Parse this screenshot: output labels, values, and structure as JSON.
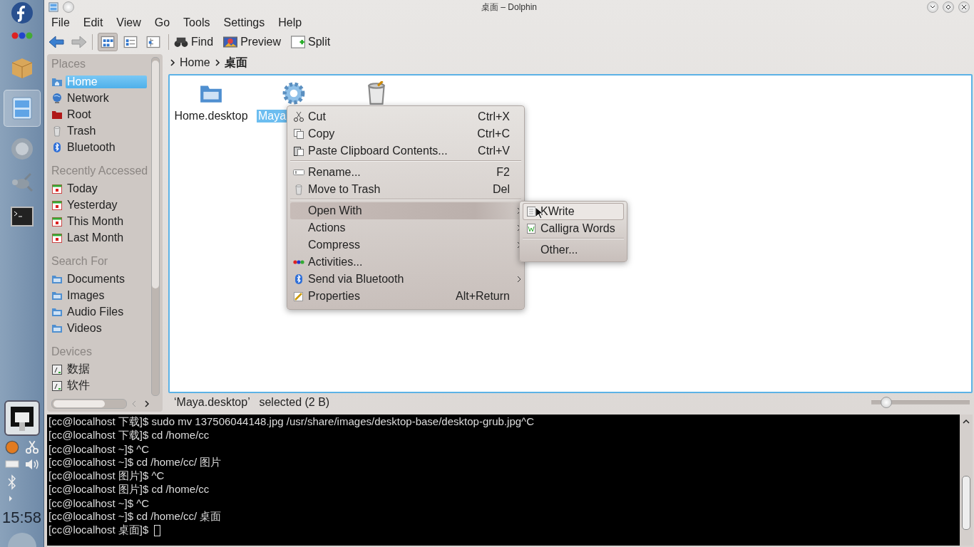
{
  "taskbar": {
    "clock": "15:58"
  },
  "window": {
    "title": "桌面 – Dolphin"
  },
  "menubar": [
    "File",
    "Edit",
    "View",
    "Go",
    "Tools",
    "Settings",
    "Help"
  ],
  "toolbar": {
    "view_modes": [
      {
        "selected": true
      },
      {
        "selected": false
      },
      {
        "selected": false
      }
    ],
    "buttons": [
      {
        "label": "Find",
        "kind": "find"
      },
      {
        "label": "Preview",
        "kind": "preview"
      },
      {
        "label": "Split",
        "kind": "split"
      }
    ]
  },
  "places": {
    "sections": [
      {
        "title": "Places",
        "items": [
          {
            "label": "Home",
            "kind": "home",
            "selected": true
          },
          {
            "label": "Network",
            "kind": "network",
            "selected": false
          },
          {
            "label": "Root",
            "kind": "root",
            "selected": false
          },
          {
            "label": "Trash",
            "kind": "trash",
            "selected": false
          },
          {
            "label": "Bluetooth",
            "kind": "bluetooth",
            "selected": false
          }
        ]
      },
      {
        "title": "Recently Accessed",
        "items": [
          {
            "label": "Today",
            "kind": "calendar",
            "selected": false
          },
          {
            "label": "Yesterday",
            "kind": "calendar",
            "selected": false
          },
          {
            "label": "This Month",
            "kind": "calendar",
            "selected": false
          },
          {
            "label": "Last Month",
            "kind": "calendar",
            "selected": false
          }
        ]
      },
      {
        "title": "Search For",
        "items": [
          {
            "label": "Documents",
            "kind": "folder",
            "selected": false
          },
          {
            "label": "Images",
            "kind": "folder",
            "selected": false
          },
          {
            "label": "Audio Files",
            "kind": "folder",
            "selected": false
          },
          {
            "label": "Videos",
            "kind": "folder",
            "selected": false
          }
        ]
      },
      {
        "title": "Devices",
        "items": [
          {
            "label": "数据",
            "kind": "drive",
            "selected": false
          },
          {
            "label": "软件",
            "kind": "drive",
            "selected": false
          }
        ]
      }
    ]
  },
  "breadcrumb": [
    "Home",
    "桌面"
  ],
  "files": [
    {
      "label": "Home.desktop",
      "kind": "folder",
      "selected": false
    },
    {
      "label": "Maya",
      "kind": "gear",
      "selected": true
    },
    {
      "kind": "bin"
    }
  ],
  "status": {
    "text": "‘Maya.desktop’   selected (2 B)",
    "zoom": {
      "level": 0.15
    }
  },
  "context_menu": {
    "items": [
      {
        "label": "Cut",
        "shortcut": "Ctrl+X",
        "kind": "cut",
        "selected": false,
        "submenu": false,
        "separator_after": false
      },
      {
        "label": "Copy",
        "shortcut": "Ctrl+C",
        "kind": "copy",
        "selected": false,
        "submenu": false,
        "separator_after": false
      },
      {
        "label": "Paste Clipboard Contents...",
        "shortcut": "Ctrl+V",
        "kind": "paste",
        "selected": false,
        "submenu": false,
        "separator_after": true
      },
      {
        "label": "Rename...",
        "shortcut": "F2",
        "kind": "rename",
        "selected": false,
        "submenu": false,
        "separator_after": false
      },
      {
        "label": "Move to Trash",
        "shortcut": "Del",
        "kind": "trash",
        "selected": false,
        "submenu": false,
        "separator_after": true
      },
      {
        "label": "Open With",
        "kind": "plain",
        "selected": true,
        "submenu": true,
        "separator_after": false
      },
      {
        "label": "Actions",
        "kind": "plain",
        "selected": false,
        "submenu": true,
        "separator_after": false
      },
      {
        "label": "Compress",
        "kind": "plain",
        "selected": false,
        "submenu": true,
        "separator_after": false
      },
      {
        "label": "Activities...",
        "kind": "activities",
        "selected": false,
        "submenu": false,
        "separator_after": false
      },
      {
        "label": "Send via Bluetooth",
        "kind": "bluetooth",
        "selected": false,
        "submenu": true,
        "separator_after": false
      },
      {
        "label": "Properties",
        "shortcut": "Alt+Return",
        "kind": "properties",
        "selected": false,
        "submenu": false,
        "separator_after": false
      }
    ]
  },
  "submenu": {
    "items": [
      {
        "label": "KWrite",
        "kind": "document",
        "selected": true,
        "separator_after": false
      },
      {
        "label": "Calligra Words",
        "kind": "words",
        "selected": false,
        "separator_after": true
      },
      {
        "label": "Other...",
        "kind": "plain",
        "selected": false,
        "separator_after": false
      }
    ]
  },
  "terminal": {
    "lines": [
      "[cc@localhost 下载]$ sudo mv 137506044148.jpg /usr/share/images/desktop-base/desktop-grub.jpg^C",
      "[cc@localhost 下载]$ cd /home/cc",
      "[cc@localhost ~]$ ^C",
      "[cc@localhost ~]$ cd /home/cc/ 图片",
      "[cc@localhost 图片]$ ^C",
      "[cc@localhost 图片]$ cd /home/cc",
      "[cc@localhost ~]$ ^C",
      "[cc@localhost ~]$ cd /home/cc/ 桌面",
      "[cc@localhost 桌面]$"
    ]
  }
}
